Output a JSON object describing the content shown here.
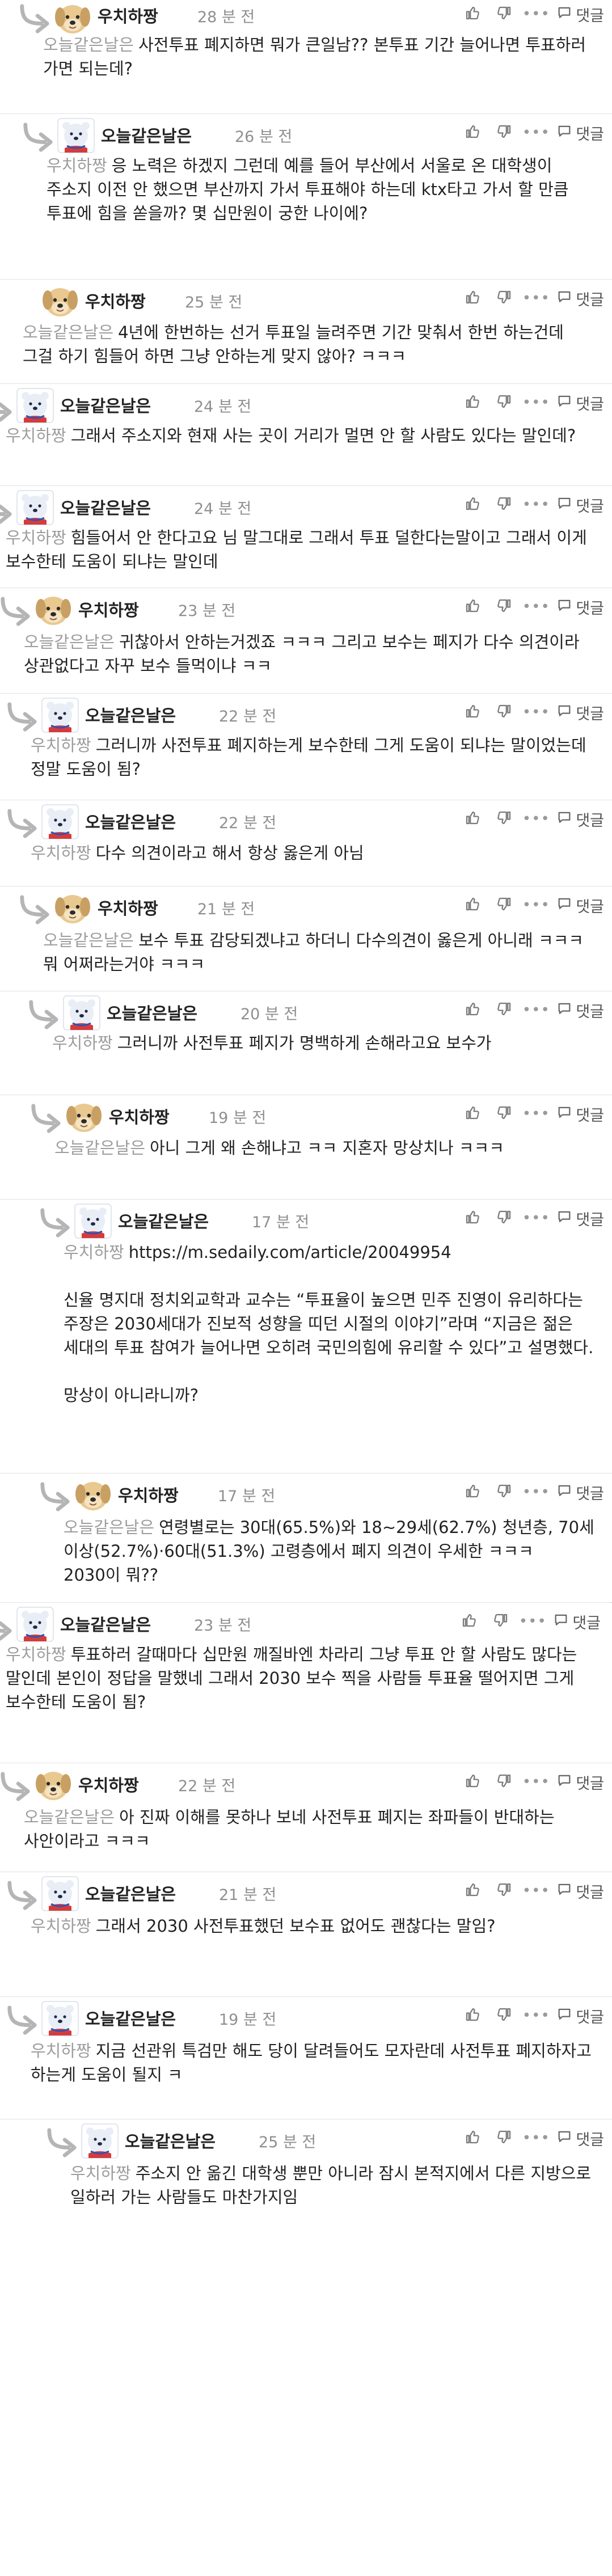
{
  "icons": {
    "like": "thumbs-up-icon",
    "dislike": "thumbs-down-icon",
    "more": "more-icon",
    "reply": "reply-icon",
    "reply_arrow": "reply-arrow-icon",
    "avatar_a": "puppy-avatar",
    "avatar_b": "polar-bear-avatar"
  },
  "labels": {
    "more": "•••",
    "reply": "댓글"
  },
  "colors": {
    "mention": "#9d9d9d",
    "time": "#8f8f8f",
    "text": "#222222",
    "divider": "#e2e2e2"
  },
  "comments": [
    {
      "author": "우치하짱",
      "time": "28 분 전",
      "mention": "오늘같은날은",
      "paras": [
        "사전투표 폐지하면 뭐가 큰일남?? 본투표 기간 늘어나면 투표하러 가면 되는데?"
      ]
    },
    {
      "author": "오늘같은날은",
      "time": "26 분 전",
      "mention": "우치하짱",
      "paras": [
        "응 노력은 하겠지 그런데 예를 들어 부산에서 서울로 온 대학생이 주소지 이전 안 했으면 부산까지 가서 투표해야 하는데 ktx타고 가서 할 만큼 투표에 힘을 쏟을까? 몇 십만원이 궁한 나이에?"
      ]
    },
    {
      "author": "우치하짱",
      "time": "25 분 전",
      "mention": "오늘같은날은",
      "paras": [
        "4년에 한번하는 선거 투표일 늘려주면 기간 맞춰서 한번 하는건데 그걸 하기 힘들어 하면 그냥 안하는게 맞지 않아? ㅋㅋㅋ"
      ]
    },
    {
      "author": "오늘같은날은",
      "time": "24 분 전",
      "mention": "우치하짱",
      "paras": [
        "그래서 주소지와 현재 사는 곳이 거리가 멀면 안 할 사람도 있다는 말인데?"
      ]
    },
    {
      "author": "오늘같은날은",
      "time": "24 분 전",
      "mention": "우치하짱",
      "paras": [
        "힘들어서 안 한다고요 님 말그대로 그래서 투표 덜한다는말이고 그래서 이게 보수한테 도움이 되냐는 말인데"
      ]
    },
    {
      "author": "우치하짱",
      "time": "23 분 전",
      "mention": "오늘같은날은",
      "paras": [
        "귀찮아서 안하는거겠죠 ㅋㅋㅋ 그리고 보수는 페지가 다수 의견이라 상관없다고 자꾸 보수 들먹이냐 ㅋㅋ"
      ]
    },
    {
      "author": "오늘같은날은",
      "time": "22 분 전",
      "mention": "우치하짱",
      "paras": [
        "그러니까 사전투표 폐지하는게 보수한테 그게 도움이 되냐는 말이었는데 정말 도움이 됨?"
      ]
    },
    {
      "author": "오늘같은날은",
      "time": "22 분 전",
      "mention": "우치하짱",
      "paras": [
        "다수 의견이라고 해서 항상 옳은게 아님"
      ]
    },
    {
      "author": "우치하짱",
      "time": "21 분 전",
      "mention": "오늘같은날은",
      "paras": [
        "보수 투표 감당되겠냐고 하더니 다수의견이 옳은게 아니래 ㅋㅋㅋ 뭐 어쩌라는거야 ㅋㅋㅋ"
      ]
    },
    {
      "author": "오늘같은날은",
      "time": "20 분 전",
      "mention": "우치하짱",
      "paras": [
        "그러니까 사전투표 페지가 명백하게 손해라고요 보수가"
      ]
    },
    {
      "author": "우치하짱",
      "time": "19 분 전",
      "mention": "오늘같은날은",
      "paras": [
        "아니 그게 왜 손해냐고 ㅋㅋ 지혼자 망상치나 ㅋㅋㅋ"
      ]
    },
    {
      "author": "오늘같은날은",
      "time": "17 분 전",
      "mention": "우치하짱",
      "paras": [
        "https://m.sedaily.com/article/20049954",
        "신율 명지대 정치외교학과 교수는 “투표율이 높으면 민주 진영이 유리하다는 주장은 2030세대가 진보적 성향을 띠던 시절의 이야기”라며 “지금은 젊은 세대의 투표 참여가 늘어나면 오히려 국민의힘에 유리할 수 있다”고 설명했다.",
        "망상이 아니라니까?"
      ]
    },
    {
      "author": "우치하짱",
      "time": "17 분 전",
      "mention": "오늘같은날은",
      "paras": [
        "연령별로는 30대(65.5%)와 18~29세(62.7%) 청년층, 70세 이상(52.7%)·60대(51.3%) 고령층에서 폐지 의견이 우세한 ㅋㅋㅋ 2030이 뭐??"
      ]
    },
    {
      "author": "오늘같은날은",
      "time": "23 분 전",
      "mention": "우치하짱",
      "paras": [
        "투표하러 갈때마다 십만원 깨질바엔 차라리 그냥 투표 안 할 사람도 많다는 말인데 본인이 정답을 말했네 그래서 2030 보수 찍을 사람들 투표율 떨어지면 그게 보수한테 도움이 됨?"
      ]
    },
    {
      "author": "우치하짱",
      "time": "22 분 전",
      "mention": "오늘같은날은",
      "paras": [
        "아 진짜 이해를 못하나 보네 사전투표 폐지는 좌파들이 반대하는 사안이라고 ㅋㅋㅋ"
      ]
    },
    {
      "author": "오늘같은날은",
      "time": "21 분 전",
      "mention": "우치하짱",
      "paras": [
        "그래서 2030 사전투표했던 보수표 없어도 괜찮다는 말임?"
      ]
    },
    {
      "author": "오늘같은날은",
      "time": "19 분 전",
      "mention": "우치하짱",
      "paras": [
        "지금 선관위 특검만 해도 당이 달려들어도 모자란데 사전투표 폐지하자고 하는게 도움이 될지 ㅋ"
      ]
    },
    {
      "author": "오늘같은날은",
      "time": "25 분 전",
      "mention": "우치하짱",
      "paras": [
        "주소지 안 옮긴 대학생 뿐만 아니라 잠시 본적지에서 다른 지방으로 일하러 가는 사람들도 마찬가지임"
      ]
    }
  ]
}
